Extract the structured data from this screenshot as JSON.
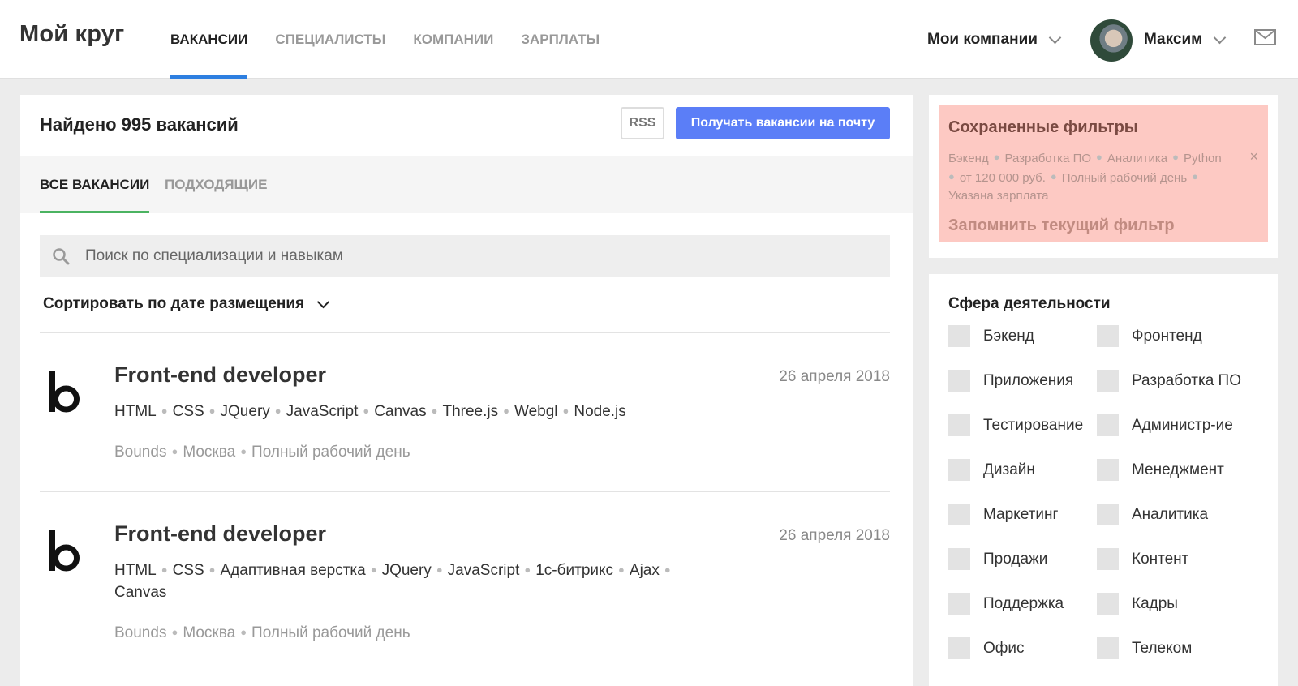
{
  "header": {
    "logo": "Мой круг",
    "nav": [
      "ВАКАНСИИ",
      "СПЕЦИАЛИСТЫ",
      "КОМПАНИИ",
      "ЗАРПЛАТЫ"
    ],
    "my_companies": "Мои компании",
    "user_name": "Максим",
    "mail_icon": "mail-icon",
    "accent_color": "#2d7fe0"
  },
  "main": {
    "found": "Найдено 995 вакансий",
    "rss": "RSS",
    "subscribe": "Получать вакансии на почту",
    "tabs": [
      "ВСЕ ВАКАНСИИ",
      "ПОДХОДЯЩИЕ"
    ],
    "search_placeholder": "Поиск по специализации и навыкам",
    "sort_label": "Сортировать по дате размещения",
    "jobs": [
      {
        "title": "Front-end developer",
        "date": "26 апреля 2018",
        "skills": [
          "HTML",
          "CSS",
          "JQuery",
          "JavaScript",
          "Canvas",
          "Three.js",
          "Webgl",
          "Node.js"
        ],
        "meta": [
          "Bounds",
          "Москва",
          "Полный рабочий день"
        ]
      },
      {
        "title": "Front-end developer",
        "date": "26 апреля 2018",
        "skills": [
          "HTML",
          "CSS",
          "Адаптивная верстка",
          "JQuery",
          "JavaScript",
          "1с-битрикс",
          "Ajax",
          "Canvas"
        ],
        "meta": [
          "Bounds",
          "Москва",
          "Полный рабочий день"
        ]
      }
    ]
  },
  "saved_filters": {
    "title": "Сохраненные фильтры",
    "items": [
      "Бэкенд",
      "Разработка ПО",
      "Аналитика",
      "Python",
      "от 120 000 руб.",
      "Полный рабочий день",
      "Указана зарплата"
    ],
    "remember": "Запомнить текущий фильтр",
    "close": "×"
  },
  "spheres": {
    "title": "Сфера деятельности",
    "items": [
      "Бэкенд",
      "Фронтенд",
      "Приложения",
      "Разработка ПО",
      "Тестирование",
      "Администр-ие",
      "Дизайн",
      "Менеджмент",
      "Маркетинг",
      "Аналитика",
      "Продажи",
      "Контент",
      "Поддержка",
      "Кадры",
      "Офис",
      "Телеком"
    ]
  }
}
